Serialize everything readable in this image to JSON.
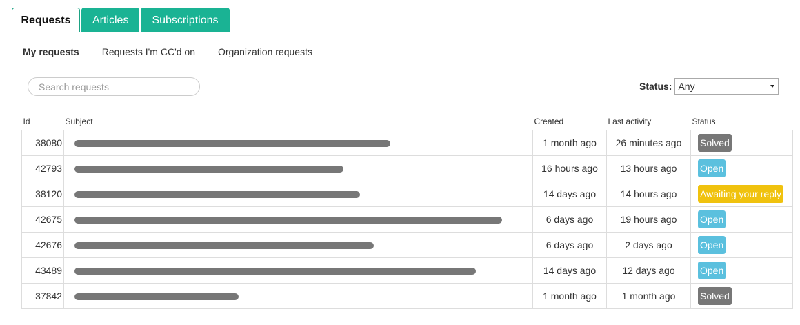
{
  "tabs": {
    "requests": "Requests",
    "articles": "Articles",
    "subscriptions": "Subscriptions"
  },
  "subnav": {
    "mine": "My requests",
    "ccd": "Requests I'm CC'd on",
    "org": "Organization requests"
  },
  "search": {
    "placeholder": "Search requests"
  },
  "status_filter": {
    "label": "Status:",
    "value": "Any"
  },
  "table": {
    "headers": {
      "id": "Id",
      "subject": "Subject",
      "created": "Created",
      "last": "Last activity",
      "status": "Status"
    },
    "rows": [
      {
        "id": "38080",
        "created": "1 month ago",
        "last": "26 minutes ago",
        "status": "Solved",
        "status_type": "solved"
      },
      {
        "id": "42793",
        "created": "16 hours ago",
        "last": "13 hours ago",
        "status": "Open",
        "status_type": "open"
      },
      {
        "id": "38120",
        "created": "14 days ago",
        "last": "14 hours ago",
        "status": "Awaiting your reply",
        "status_type": "await"
      },
      {
        "id": "42675",
        "created": "6 days ago",
        "last": "19 hours ago",
        "status": "Open",
        "status_type": "open"
      },
      {
        "id": "42676",
        "created": "6 days ago",
        "last": "2 days ago",
        "status": "Open",
        "status_type": "open"
      },
      {
        "id": "43489",
        "created": "14 days ago",
        "last": "12 days ago",
        "status": "Open",
        "status_type": "open"
      },
      {
        "id": "37842",
        "created": "1 month ago",
        "last": "1 month ago",
        "status": "Solved",
        "status_type": "solved"
      }
    ]
  },
  "colors": {
    "accent": "#1ab394",
    "solved": "#777777",
    "open": "#5bc0de",
    "await": "#f0c20e"
  }
}
